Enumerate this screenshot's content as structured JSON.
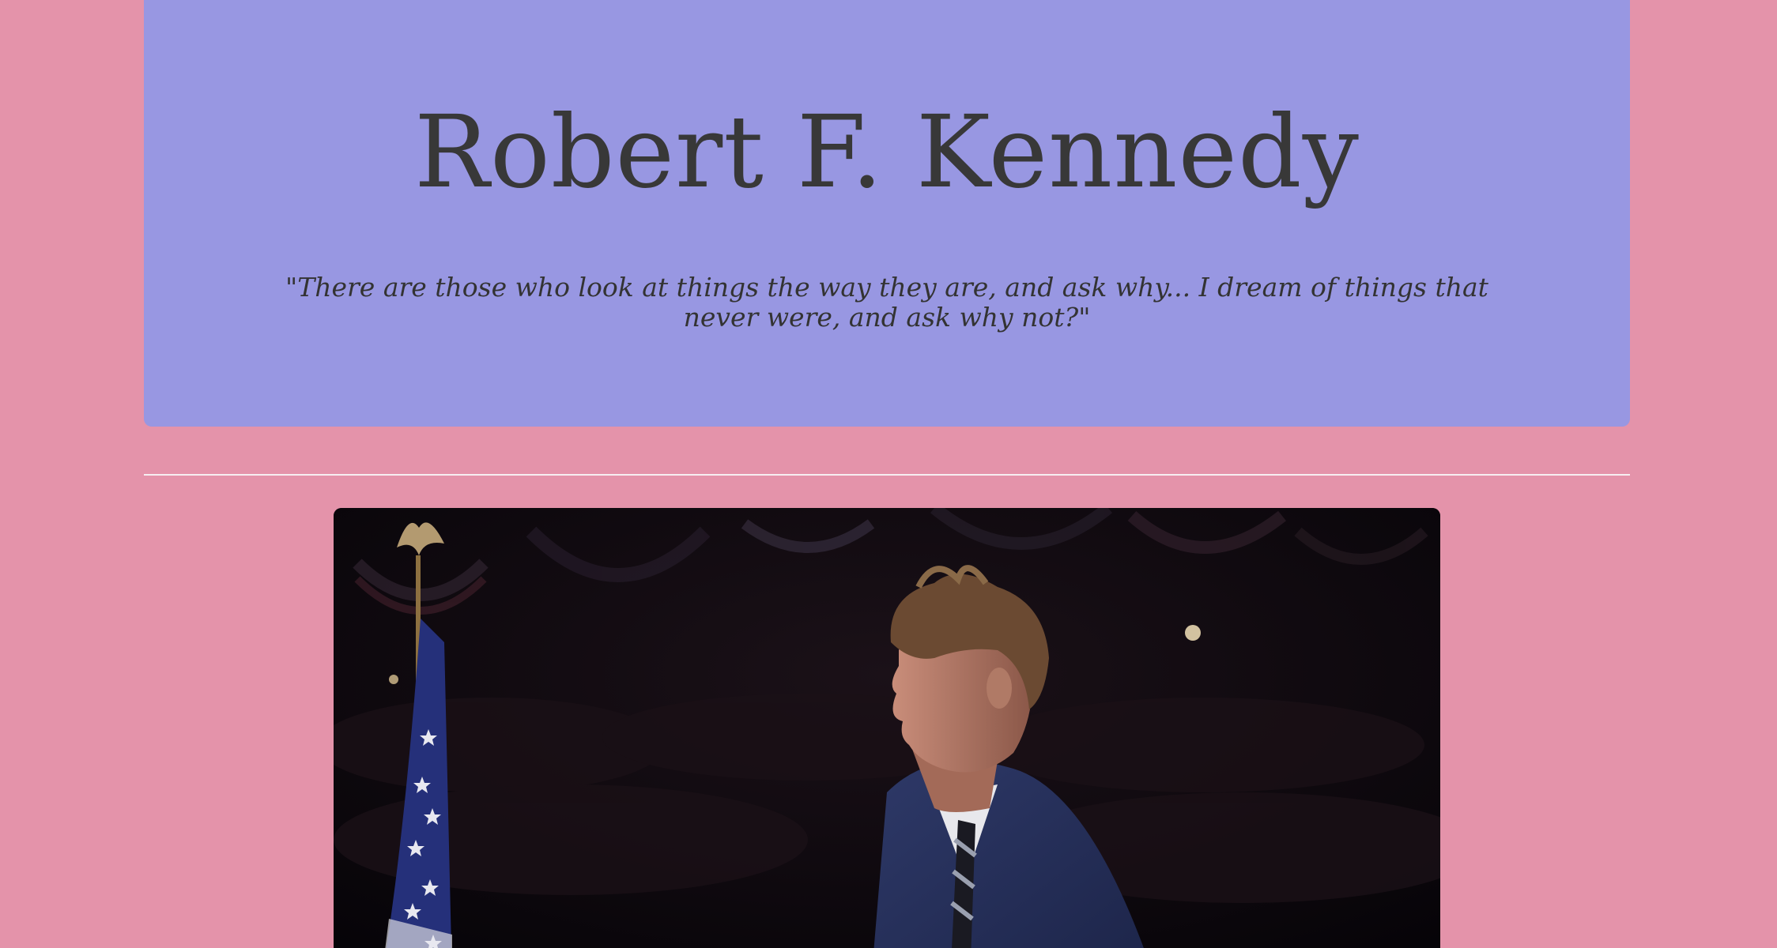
{
  "header": {
    "title": "Robert F. Kennedy",
    "quote": "\"There are those who look at things the way they are, and ask why... I dream of things that never were, and ask why not?\""
  },
  "colors": {
    "background": "#e493aa",
    "jumbotron": "#9897e2",
    "text": "#383838",
    "divider": "#f7eef1"
  },
  "main": {
    "image_alt": "Robert F. Kennedy"
  }
}
